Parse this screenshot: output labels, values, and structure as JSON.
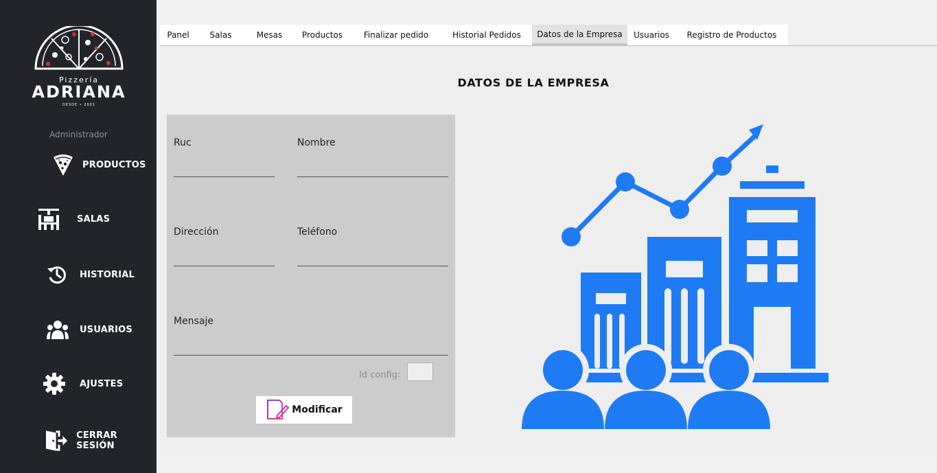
{
  "sidebar": {
    "brand_small": "Pizzería",
    "brand_name": "ADRIANA",
    "brand_since": "DESDE • 2001",
    "role": "Administrador",
    "items": [
      {
        "label": "PRODUCTOS",
        "icon": "pizza-icon"
      },
      {
        "label": "SALAS",
        "icon": "table-icon"
      },
      {
        "label": "HISTORIAL",
        "icon": "history-icon"
      },
      {
        "label": "USUARIOS",
        "icon": "users-icon"
      },
      {
        "label": "AJUSTES",
        "icon": "gear-icon"
      },
      {
        "label": "CERRAR SESIÓN",
        "icon": "logout-icon"
      }
    ]
  },
  "tabs": [
    {
      "label": "Panel"
    },
    {
      "label": "Salas"
    },
    {
      "label": "Mesas"
    },
    {
      "label": "Productos"
    },
    {
      "label": "Finalizar pedido"
    },
    {
      "label": "Historial Pedidos"
    },
    {
      "label": "Datos de la Empresa",
      "active": true
    },
    {
      "label": "Usuarios"
    },
    {
      "label": "Registro de Productos"
    }
  ],
  "main": {
    "title": "DATOS DE LA EMPRESA",
    "form": {
      "ruc_label": "Ruc",
      "ruc_value": "",
      "nombre_label": "Nombre",
      "nombre_value": "",
      "direccion_label": "Dirección",
      "direccion_value": "",
      "telefono_label": "Teléfono",
      "telefono_value": "",
      "mensaje_label": "Mensaje",
      "mensaje_value": "",
      "idconfig_label": "Id config:",
      "idconfig_value": "",
      "modify_label": "Modificar"
    }
  },
  "colors": {
    "sidebar_bg": "#222429",
    "illustration_blue": "#1e7bf3",
    "form_bg": "#cccccc"
  }
}
